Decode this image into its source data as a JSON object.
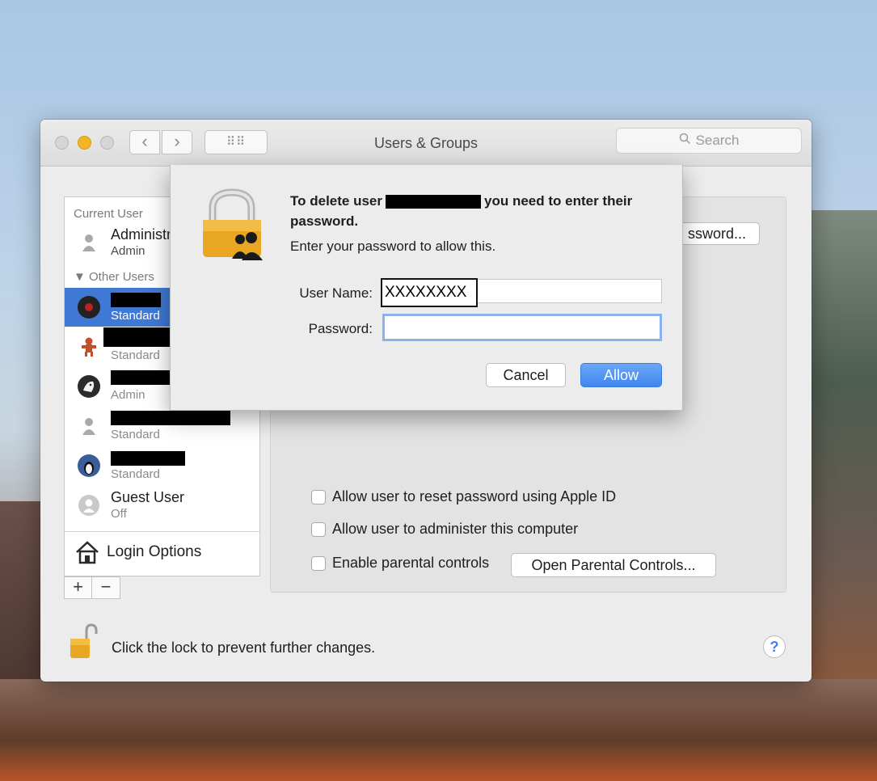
{
  "window": {
    "title": "Users & Groups",
    "search_placeholder": "Search"
  },
  "sidebar": {
    "current_user_header": "Current User",
    "current_user": {
      "name": "Administr",
      "role": "Admin"
    },
    "other_users_header": "Other Users",
    "users": [
      {
        "role": "Standard",
        "selected": true
      },
      {
        "role": "Standard"
      },
      {
        "role": "Admin"
      },
      {
        "role": "Standard"
      },
      {
        "role": "Standard"
      }
    ],
    "guest": {
      "name": "Guest User",
      "status": "Off"
    },
    "login_options_label": "Login Options",
    "add_label": "+",
    "remove_label": "−"
  },
  "panel": {
    "reset_password_button": "ssword...",
    "checkboxes": [
      {
        "label": "Allow user to reset password using Apple ID",
        "checked": false
      },
      {
        "label": "Allow user to administer this computer",
        "checked": false
      },
      {
        "label": "Enable parental controls",
        "checked": false
      }
    ],
    "parental_controls_button": "Open Parental Controls..."
  },
  "footer": {
    "lock_text": "Click the lock to prevent further changes.",
    "help_label": "?"
  },
  "dialog": {
    "title_prefix": "To delete user",
    "title_suffix": "you need to enter their password.",
    "subtitle": "Enter your password to allow this.",
    "username_label": "User Name:",
    "username_value": "XXXXXXXX",
    "password_label": "Password:",
    "password_value": "",
    "cancel_label": "Cancel",
    "allow_label": "Allow"
  },
  "colors": {
    "selection_blue": "#3f78d5",
    "allow_button": "#3f86ee",
    "minimize_yellow": "#f3b425",
    "lock_gold": "#e8a622"
  }
}
